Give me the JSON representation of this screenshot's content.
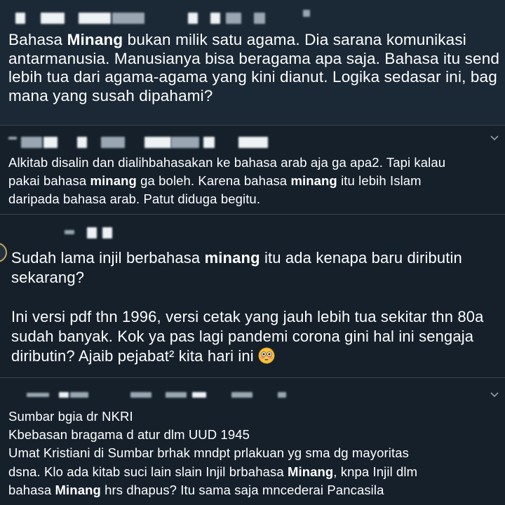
{
  "tweets": [
    {
      "lines": [
        {
          "pre": "Bahasa ",
          "kw": "Minang",
          "post": " bukan milik satu agama. Dia sarana komunikasi"
        },
        {
          "pre": "antarmanusia. Manusianya bisa beragama apa saja. Bahasa itu send",
          "kw": "",
          "post": ""
        },
        {
          "pre": "lebih tua dari agama-agama yang kini dianut. Logika sedasar ini, bag",
          "kw": "",
          "post": ""
        },
        {
          "pre": "mana yang susah dipahami?",
          "kw": "",
          "post": ""
        }
      ]
    },
    {
      "lines": [
        {
          "pre": "Alkitab disalin dan dialihbahasakan ke bahasa arab aja ga apa2. Tapi kalau",
          "kw": "",
          "post": ""
        },
        {
          "pre": "pakai bahasa ",
          "kw": "minang",
          "post": " ga boleh. Karena bahasa ",
          "kw2": "minang",
          "post2": " itu lebih Islam"
        },
        {
          "pre": "daripada bahasa arab. Patut diduga begitu.",
          "kw": "",
          "post": ""
        }
      ]
    },
    {
      "lines": [
        {
          "pre": "Sudah lama injil berbahasa ",
          "kw": "minang",
          "post": " itu ada kenapa baru diributin"
        },
        {
          "pre": "sekarang?",
          "kw": "",
          "post": ""
        },
        {
          "pre": "",
          "kw": "",
          "post": "",
          "gap": true
        },
        {
          "pre": "Ini versi pdf thn 1996, versi cetak yang jauh lebih tua sekitar thn 80a",
          "kw": "",
          "post": ""
        },
        {
          "pre": "sudah banyak. Kok ya pas lagi pandemi corona gini hal ini sengaja",
          "kw": "",
          "post": ""
        },
        {
          "pre": "diributin? Ajaib pejabat² kita hari ini",
          "kw": "",
          "post": "",
          "emoji": "flushed-face"
        }
      ]
    },
    {
      "lines": [
        {
          "pre": "Sumbar bgia dr NKRI",
          "kw": "",
          "post": ""
        },
        {
          "pre": "Kbebasan bragama d atur dlm UUD 1945",
          "kw": "",
          "post": ""
        },
        {
          "pre": "Umat Kristiani di Sumbar brhak mndpt prlakuan yg sma dg mayoritas",
          "kw": "",
          "post": ""
        },
        {
          "pre": "dsna. Klo ada kitab suci lain slain Injil brbahasa ",
          "kw": "Minang",
          "post": ", knpa Injil dlm"
        },
        {
          "pre": "bahasa ",
          "kw": "Minang",
          "post": " hrs dhapus? Itu sama saja mncederai Pancasila"
        }
      ]
    }
  ],
  "colors": {
    "background": "#15202b",
    "background_alt": "#1b2836",
    "divider": "#38444d",
    "text": "#ffffff",
    "icon": "#8899a6"
  }
}
